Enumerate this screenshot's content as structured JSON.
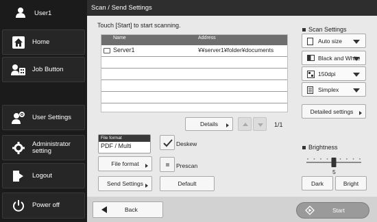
{
  "sidebar": {
    "user": "User1",
    "home": "Home",
    "job_button": "Job Button",
    "user_settings": "User Settings",
    "admin_line1": "Administrator",
    "admin_line2": "setting",
    "logout": "Logout",
    "power_off": "Power off"
  },
  "header": {
    "title": "Scan / Send Settings"
  },
  "main": {
    "instruction": "Touch [Start] to start scanning.",
    "table": {
      "col_name": "Name",
      "col_address": "Address",
      "rows": [
        {
          "name": "Server1",
          "address": "¥¥server1¥folder¥documents"
        }
      ]
    },
    "details_label": "Details",
    "page_indicator": "1/1",
    "file_format_caption": "File format",
    "file_format_value": "PDF / Multi",
    "file_format_button": "File format",
    "send_settings_button": "Send Settings",
    "deskew_label": "Deskew",
    "deskew_checked": true,
    "prescan_label": "Prescan",
    "prescan_checked": false,
    "default_button": "Default"
  },
  "scan_settings": {
    "title": "Scan Settings",
    "size": "Auto size",
    "color": "Black and White",
    "resolution": "150dpi",
    "sides": "Simplex",
    "detailed_button": "Detailed settings"
  },
  "brightness": {
    "title": "Brightness",
    "value": "5",
    "level_fraction": 0.5,
    "dark_label": "Dark",
    "bright_label": "Bright"
  },
  "footer": {
    "back_label": "Back",
    "start_label": "Start"
  }
}
